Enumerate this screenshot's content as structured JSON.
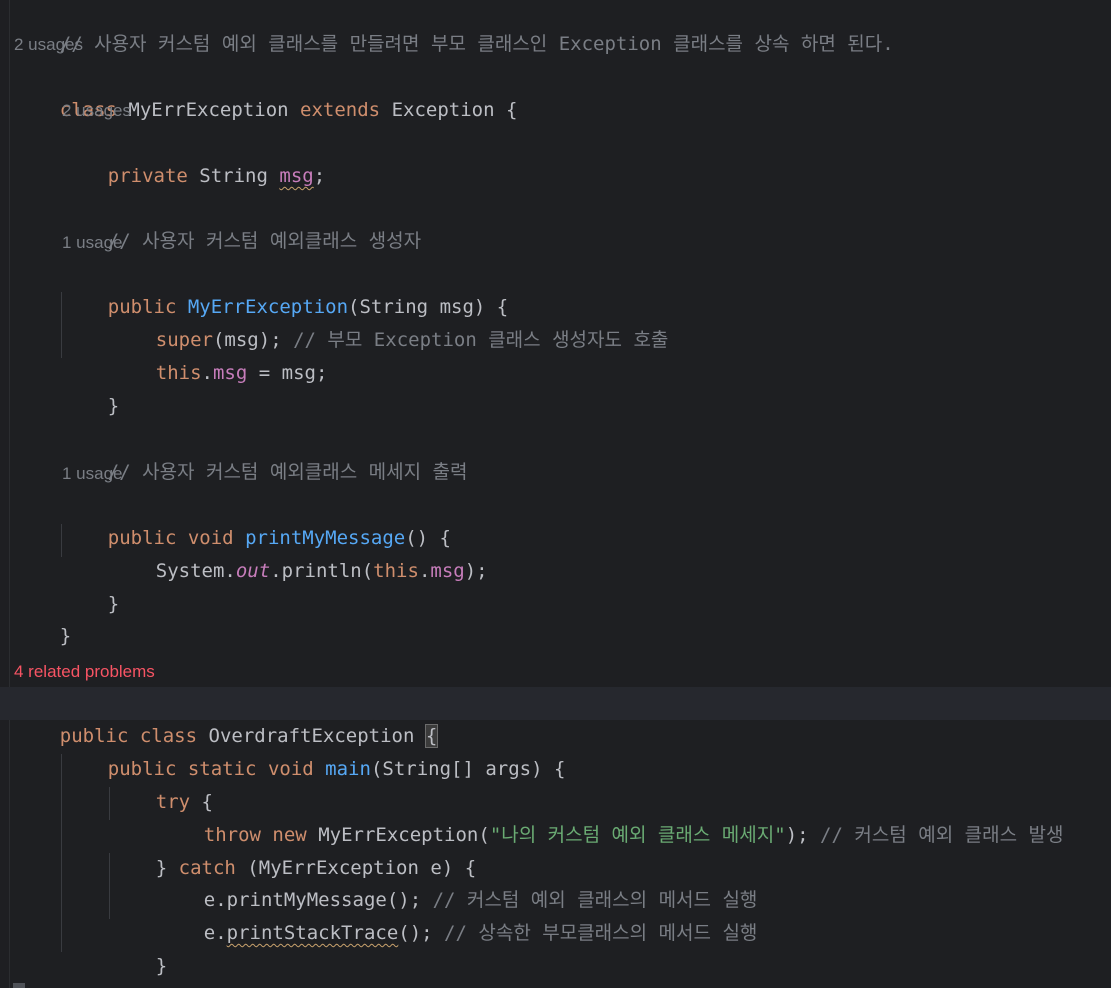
{
  "editor": {
    "top_comment": "// 사용자 커스텀 예외 클래스를 만들려면 부모 클래스인 Exception 클래스를 상속 하면 된다.",
    "hint_2_usages": "2 usages",
    "hint_1_usage": "1 usage",
    "hint_problems": "4 related problems",
    "kw_class": "class",
    "kw_extends": "extends",
    "kw_private": "private",
    "kw_public": "public",
    "kw_void": "void",
    "kw_static": "static",
    "kw_super": "super",
    "kw_this": "this",
    "kw_try": "try",
    "kw_throw": "throw",
    "kw_new": "new",
    "kw_catch": "catch",
    "cls_myerr": "MyErrException",
    "cls_exception": "Exception",
    "cls_overdraft": "OverdraftException",
    "type_string": "String",
    "type_system": "System",
    "field_msg": "msg",
    "field_out": "out",
    "method_println": "println",
    "method_printmymessage": "printMyMessage",
    "method_printstacktrace": "printStackTrace",
    "method_main": "main",
    "var_args": "args",
    "var_e": "e",
    "comment_ctor": "// 사용자 커스텀 예외클래스 생성자",
    "comment_super": "// 부모 Exception 클래스 생성자도 호출",
    "comment_print": "// 사용자 커스텀 예외클래스 메세지 출력",
    "string_msg": "\"나의 커스텀 예외 클래스 메세지\"",
    "comment_throw": "// 커스텀 예외 클래스 발생",
    "comment_call_own": "// 커스텀 예외 클래스의 메서드 실행",
    "comment_call_parent": "// 상속한 부모클래스의 메서드 실행"
  },
  "colors": {
    "background": "#1e1f22",
    "keyword": "#cf8e6d",
    "method_decl": "#56a8f5",
    "field": "#c77dbb",
    "string": "#6aab73",
    "comment": "#7a7e85",
    "error": "#f75464"
  }
}
